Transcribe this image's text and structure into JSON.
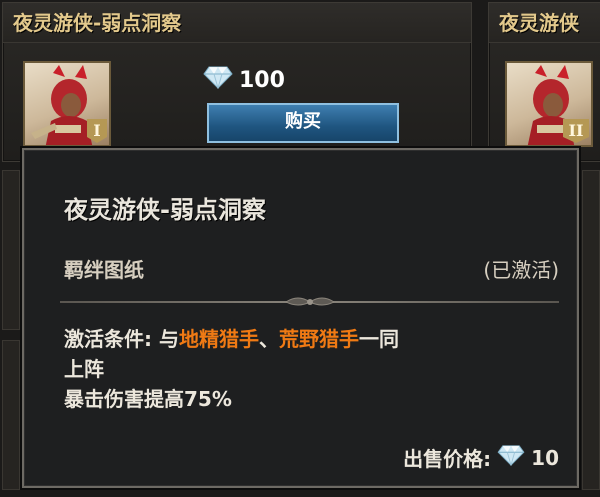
{
  "card_left": {
    "title": "夜灵游侠-弱点洞察",
    "price": "100",
    "buy_label": "购买",
    "tier": "I"
  },
  "card_right": {
    "title": "夜灵游侠",
    "tier": "II"
  },
  "tooltip": {
    "title": "夜灵游侠-弱点洞察",
    "type": "羁绊图纸",
    "status": "(已激活)",
    "condition_prefix": "激活条件: 与",
    "hero1": "地精猎手",
    "separator": "、",
    "hero2": "荒野猎手",
    "condition_suffix": "一同",
    "condition_line2": "上阵",
    "effect": "暴击伤害提高75%",
    "sell_label": "出售价格:",
    "sell_price": "10"
  },
  "colors": {
    "highlight": "#f07a14",
    "title_gold": "#e3c98c",
    "button_blue": "#1f5580"
  },
  "icons": [
    "diamond-icon",
    "hero-portrait",
    "ornament"
  ]
}
